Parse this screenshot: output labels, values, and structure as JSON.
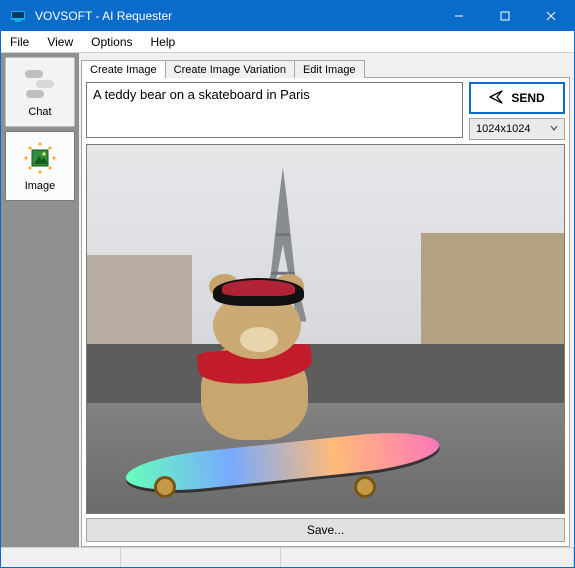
{
  "window": {
    "title": "VOVSOFT - AI Requester"
  },
  "menubar": {
    "items": [
      "File",
      "View",
      "Options",
      "Help"
    ]
  },
  "sidebar": {
    "chat_label": "Chat",
    "image_label": "Image"
  },
  "tabs": {
    "create": "Create Image",
    "variation": "Create Image Variation",
    "edit": "Edit Image"
  },
  "prompt": {
    "value": "A teddy bear on a skateboard in Paris"
  },
  "send": {
    "label": "SEND"
  },
  "size_select": {
    "selected": "1024x1024"
  },
  "save": {
    "label": "Save..."
  }
}
